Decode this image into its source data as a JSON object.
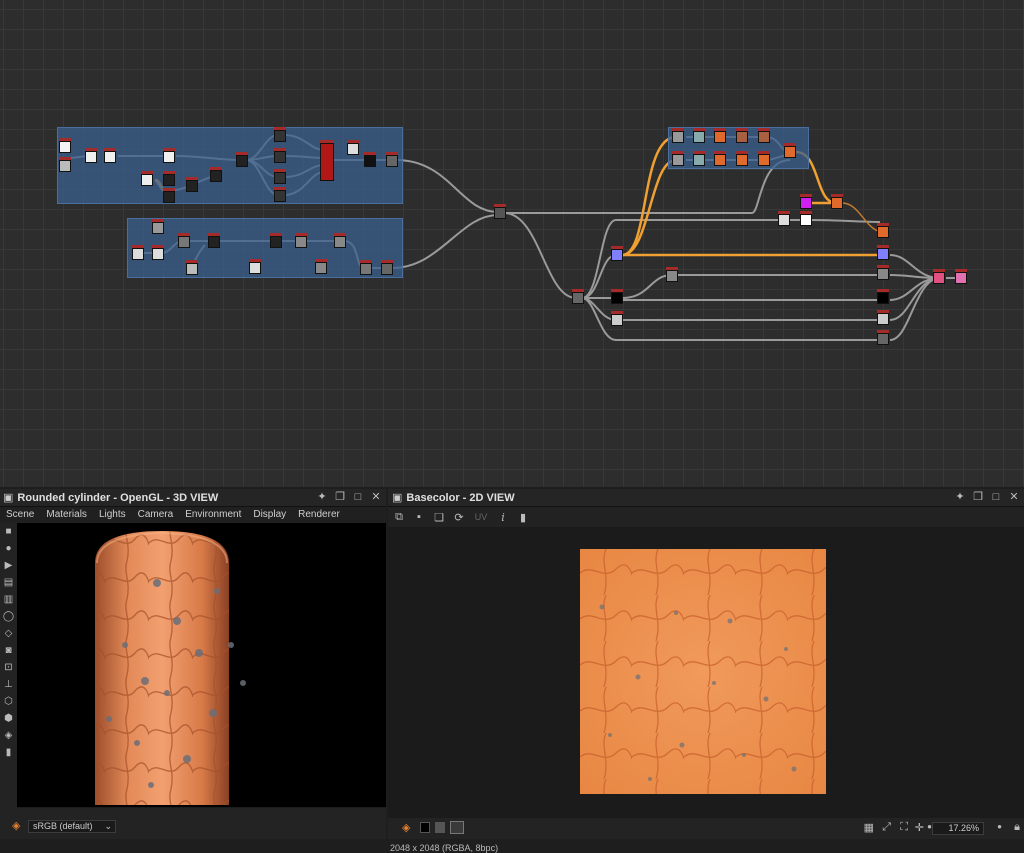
{
  "graph": {
    "accent_link": "#f0a030",
    "link_color": "#9a9a9a",
    "frame_color": "#3a5f8c"
  },
  "view3d": {
    "title": "Rounded cylinder - OpenGL - 3D VIEW",
    "menu": [
      "Scene",
      "Materials",
      "Lights",
      "Camera",
      "Environment",
      "Display",
      "Renderer"
    ],
    "colorspace": "sRGB (default)"
  },
  "view2d": {
    "title": "Basecolor - 2D VIEW",
    "uv_label": "UV",
    "resolution": "2048 x 2048 (RGBA, 8bpc)",
    "zoom": "17.26%"
  },
  "material": {
    "base": "#e88a4a",
    "vein": "#b8532a",
    "spot": "#6b6e78"
  }
}
